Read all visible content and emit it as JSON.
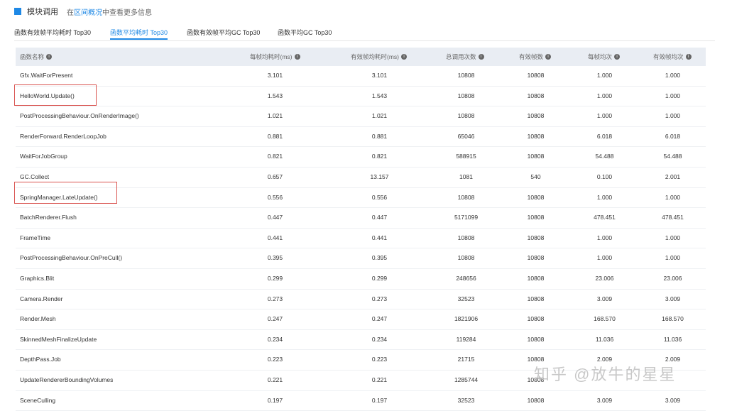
{
  "header": {
    "title": "模块调用",
    "prefix": "在",
    "link": "区间概况",
    "suffix": "中查看更多信息"
  },
  "tabs": [
    {
      "label": "函数有效帧平均耗时 Top30",
      "active": false
    },
    {
      "label": "函数平均耗时 Top30",
      "active": true
    },
    {
      "label": "函数有效帧平均GC Top30",
      "active": false
    },
    {
      "label": "函数平均GC Top30",
      "active": false
    }
  ],
  "table": {
    "columns": [
      "函数名称",
      "每帧均耗时(ms)",
      "有效帧均耗时(ms)",
      "总调用次数",
      "有效帧数",
      "每帧均次",
      "有效帧均次"
    ],
    "rows": [
      [
        "Gfx.WaitForPresent",
        "3.101",
        "3.101",
        "10808",
        "10808",
        "1.000",
        "1.000"
      ],
      [
        "HelloWorld.Update()",
        "1.543",
        "1.543",
        "10808",
        "10808",
        "1.000",
        "1.000"
      ],
      [
        "PostProcessingBehaviour.OnRenderImage()",
        "1.021",
        "1.021",
        "10808",
        "10808",
        "1.000",
        "1.000"
      ],
      [
        "RenderForward.RenderLoopJob",
        "0.881",
        "0.881",
        "65046",
        "10808",
        "6.018",
        "6.018"
      ],
      [
        "WaitForJobGroup",
        "0.821",
        "0.821",
        "588915",
        "10808",
        "54.488",
        "54.488"
      ],
      [
        "GC.Collect",
        "0.657",
        "13.157",
        "1081",
        "540",
        "0.100",
        "2.001"
      ],
      [
        "SpringManager.LateUpdate()",
        "0.556",
        "0.556",
        "10808",
        "10808",
        "1.000",
        "1.000"
      ],
      [
        "BatchRenderer.Flush",
        "0.447",
        "0.447",
        "5171099",
        "10808",
        "478.451",
        "478.451"
      ],
      [
        "FrameTime",
        "0.441",
        "0.441",
        "10808",
        "10808",
        "1.000",
        "1.000"
      ],
      [
        "PostProcessingBehaviour.OnPreCull()",
        "0.395",
        "0.395",
        "10808",
        "10808",
        "1.000",
        "1.000"
      ],
      [
        "Graphics.Blit",
        "0.299",
        "0.299",
        "248656",
        "10808",
        "23.006",
        "23.006"
      ],
      [
        "Camera.Render",
        "0.273",
        "0.273",
        "32523",
        "10808",
        "3.009",
        "3.009"
      ],
      [
        "Render.Mesh",
        "0.247",
        "0.247",
        "1821906",
        "10808",
        "168.570",
        "168.570"
      ],
      [
        "SkinnedMeshFinalizeUpdate",
        "0.234",
        "0.234",
        "119284",
        "10808",
        "11.036",
        "11.036"
      ],
      [
        "DepthPass.Job",
        "0.223",
        "0.223",
        "21715",
        "10808",
        "2.009",
        "2.009"
      ],
      [
        "UpdateRendererBoundingVolumes",
        "0.221",
        "0.221",
        "1285744",
        "10808",
        "",
        ""
      ],
      [
        "SceneCulling",
        "0.197",
        "0.197",
        "32523",
        "10808",
        "3.009",
        "3.009"
      ]
    ]
  },
  "highlights": [
    "HelloWorld.Update()",
    "SpringManager.LateUpdate()"
  ],
  "watermark": "知乎 @放牛的星星"
}
